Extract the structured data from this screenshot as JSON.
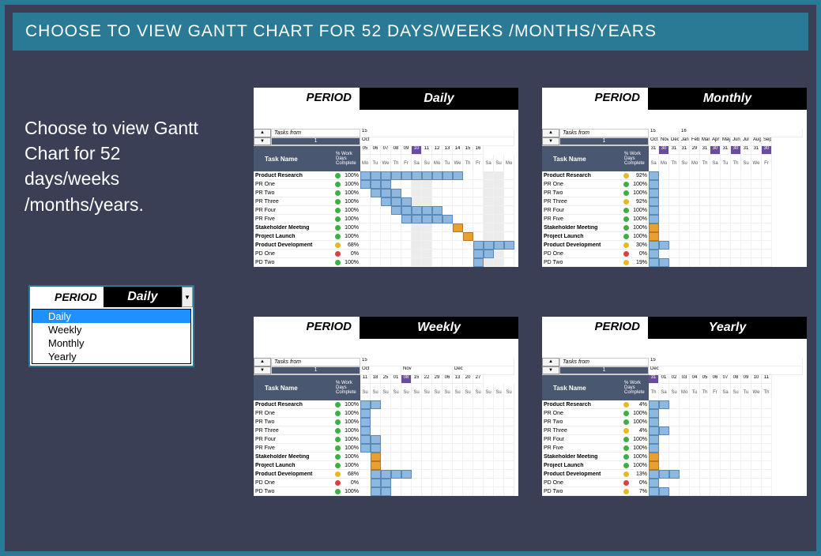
{
  "title": "CHOOSE TO VIEW GANTT CHART FOR 52 DAYS/WEEKS /MONTHS/YEARS",
  "description": "Choose to view Gantt Chart for 52 days/weeks /months/years.",
  "selector": {
    "label": "PERIOD",
    "value": "Daily",
    "options": [
      "Daily",
      "Weekly",
      "Monthly",
      "Yearly"
    ],
    "highlighted": "Daily"
  },
  "panel_label": "PERIOD",
  "tasks_from_label": "Tasks from",
  "tasks_from_value": "1",
  "task_name_header": "Task Name",
  "work_days_header": "% Work Days Complete",
  "tasks": [
    {
      "name": "Product Research",
      "bold": true
    },
    {
      "name": "PR One"
    },
    {
      "name": "PR Two"
    },
    {
      "name": "PR Three"
    },
    {
      "name": "PR Four"
    },
    {
      "name": "PR Five"
    },
    {
      "name": "Stakeholder Meeting",
      "bold": true
    },
    {
      "name": "Project Launch",
      "bold": true
    },
    {
      "name": "Product Development",
      "bold": true
    },
    {
      "name": "PD One"
    },
    {
      "name": "PD Two"
    }
  ],
  "panels": {
    "daily": {
      "value": "Daily",
      "month_row": [
        {
          "text": "15",
          "span": 15
        }
      ],
      "group_row": [
        {
          "text": "Oct",
          "span": 15
        }
      ],
      "num_row": [
        "05",
        "06",
        "07",
        "08",
        "09",
        "10",
        "11",
        "12",
        "13",
        "14",
        "15",
        "16"
      ],
      "highlighted_num": "10",
      "day_row": [
        "Mo",
        "Tu",
        "We",
        "Th",
        "Fr",
        "Sa",
        "Su",
        "Mo",
        "Tu",
        "We",
        "Th",
        "Fr",
        "Sa",
        "Su",
        "Mo"
      ],
      "weekend_cols": [
        5,
        6,
        12,
        13
      ],
      "pcts": [
        "100%",
        "100%",
        "100%",
        "100%",
        "100%",
        "100%",
        "100%",
        "100%",
        "68%",
        "0%",
        "100%"
      ],
      "dots": [
        "green",
        "green",
        "green",
        "green",
        "green",
        "green",
        "green",
        "green",
        "yellow",
        "red",
        "green"
      ],
      "bars": [
        [
          [
            0,
            9,
            "bar"
          ]
        ],
        [
          [
            0,
            2,
            "bar"
          ]
        ],
        [
          [
            1,
            3,
            "bar"
          ]
        ],
        [
          [
            2,
            4,
            "bar"
          ]
        ],
        [
          [
            3,
            7,
            "bar"
          ]
        ],
        [
          [
            4,
            8,
            "bar"
          ]
        ],
        [
          [
            9,
            9,
            "bar-amber"
          ]
        ],
        [
          [
            10,
            10,
            "bar-amber"
          ]
        ],
        [
          [
            11,
            14,
            "bar"
          ]
        ],
        [
          [
            11,
            12,
            "bar"
          ]
        ],
        [
          [
            11,
            11,
            "bar"
          ]
        ]
      ]
    },
    "weekly": {
      "value": "Weekly",
      "month_row": [
        {
          "text": "15",
          "span": 15
        }
      ],
      "group_row": [
        {
          "text": "Oct",
          "span": 4
        },
        {
          "text": "Nov",
          "span": 5
        },
        {
          "text": "Dec",
          "span": 6
        }
      ],
      "num_row": [
        "11",
        "18",
        "25",
        "01",
        "08",
        "15",
        "22",
        "29",
        "06",
        "13",
        "20",
        "27"
      ],
      "highlighted_num": "08",
      "day_row": [
        "Su",
        "Su",
        "Su",
        "Su",
        "Su",
        "Su",
        "Su",
        "Su",
        "Su",
        "Su",
        "Su",
        "Su",
        "Su",
        "Su",
        "Su"
      ],
      "weekend_cols": [],
      "pcts": [
        "100%",
        "100%",
        "100%",
        "100%",
        "100%",
        "100%",
        "100%",
        "100%",
        "68%",
        "0%",
        "100%"
      ],
      "dots": [
        "green",
        "green",
        "green",
        "green",
        "green",
        "green",
        "green",
        "green",
        "yellow",
        "red",
        "green"
      ],
      "bars": [
        [
          [
            0,
            1,
            "bar"
          ]
        ],
        [
          [
            0,
            0,
            "bar"
          ]
        ],
        [
          [
            0,
            0,
            "bar"
          ]
        ],
        [
          [
            0,
            0,
            "bar"
          ]
        ],
        [
          [
            0,
            1,
            "bar"
          ]
        ],
        [
          [
            0,
            1,
            "bar"
          ]
        ],
        [
          [
            1,
            1,
            "bar-amber"
          ]
        ],
        [
          [
            1,
            1,
            "bar-amber"
          ]
        ],
        [
          [
            1,
            4,
            "bar"
          ]
        ],
        [
          [
            1,
            2,
            "bar"
          ]
        ],
        [
          [
            1,
            2,
            "bar"
          ]
        ]
      ]
    },
    "monthly": {
      "value": "Monthly",
      "month_row": [
        {
          "text": "15",
          "span": 3
        },
        {
          "text": "16",
          "span": 12
        }
      ],
      "group_row": [
        {
          "text": "Oct",
          "span": 1
        },
        {
          "text": "Nov",
          "span": 1
        },
        {
          "text": "Dec",
          "span": 1
        },
        {
          "text": "Jan",
          "span": 1
        },
        {
          "text": "Feb",
          "span": 1
        },
        {
          "text": "Mar",
          "span": 1
        },
        {
          "text": "Apr",
          "span": 1
        },
        {
          "text": "May",
          "span": 1
        },
        {
          "text": "Jun",
          "span": 1
        },
        {
          "text": "Jul",
          "span": 1
        },
        {
          "text": "Aug",
          "span": 1
        },
        {
          "text": "Sep",
          "span": 1
        }
      ],
      "num_row": [
        "31",
        "30",
        "31",
        "31",
        "29",
        "31",
        "30",
        "31",
        "30",
        "31",
        "31",
        "30"
      ],
      "highlighted_num": "30",
      "day_row": [
        "Sa",
        "Mo",
        "Th",
        "Su",
        "Mo",
        "Th",
        "Sa",
        "Tu",
        "Th",
        "Su",
        "We",
        "Fr"
      ],
      "weekend_cols": [],
      "pcts": [
        "92%",
        "100%",
        "100%",
        "92%",
        "100%",
        "100%",
        "100%",
        "100%",
        "30%",
        "0%",
        "19%"
      ],
      "dots": [
        "yellow",
        "green",
        "green",
        "yellow",
        "green",
        "green",
        "green",
        "green",
        "yellow",
        "red",
        "yellow"
      ],
      "bars": [
        [
          [
            0,
            0,
            "bar"
          ]
        ],
        [
          [
            0,
            0,
            "bar"
          ]
        ],
        [
          [
            0,
            0,
            "bar"
          ]
        ],
        [
          [
            0,
            0,
            "bar"
          ]
        ],
        [
          [
            0,
            0,
            "bar"
          ]
        ],
        [
          [
            0,
            0,
            "bar"
          ]
        ],
        [
          [
            0,
            0,
            "bar-amber"
          ]
        ],
        [
          [
            0,
            0,
            "bar-amber"
          ]
        ],
        [
          [
            0,
            1,
            "bar"
          ]
        ],
        [
          [
            0,
            0,
            "bar"
          ]
        ],
        [
          [
            0,
            1,
            "bar"
          ]
        ]
      ]
    },
    "yearly": {
      "value": "Yearly",
      "month_row": [
        {
          "text": "15",
          "span": 15
        }
      ],
      "group_row": [
        {
          "text": "Dec",
          "span": 15
        }
      ],
      "num_row": [
        "31",
        "01",
        "02",
        "03",
        "04",
        "05",
        "06",
        "07",
        "08",
        "09",
        "10",
        "11"
      ],
      "highlighted_num": "31",
      "day_row": [
        "Th",
        "Sa",
        "Su",
        "Mo",
        "Tu",
        "Th",
        "Fr",
        "Sa",
        "Su",
        "Tu",
        "We",
        "Th"
      ],
      "weekend_cols": [],
      "pcts": [
        "4%",
        "100%",
        "100%",
        "4%",
        "100%",
        "100%",
        "100%",
        "100%",
        "13%",
        "0%",
        "7%"
      ],
      "dots": [
        "yellow",
        "green",
        "green",
        "yellow",
        "green",
        "green",
        "green",
        "green",
        "yellow",
        "red",
        "yellow"
      ],
      "bars": [
        [
          [
            0,
            1,
            "bar"
          ]
        ],
        [
          [
            0,
            0,
            "bar"
          ]
        ],
        [
          [
            0,
            0,
            "bar"
          ]
        ],
        [
          [
            0,
            1,
            "bar"
          ]
        ],
        [
          [
            0,
            0,
            "bar"
          ]
        ],
        [
          [
            0,
            0,
            "bar"
          ]
        ],
        [
          [
            0,
            0,
            "bar-amber"
          ]
        ],
        [
          [
            0,
            0,
            "bar-amber"
          ]
        ],
        [
          [
            0,
            2,
            "bar"
          ]
        ],
        [
          [
            0,
            0,
            "bar"
          ]
        ],
        [
          [
            0,
            1,
            "bar"
          ]
        ]
      ]
    }
  }
}
